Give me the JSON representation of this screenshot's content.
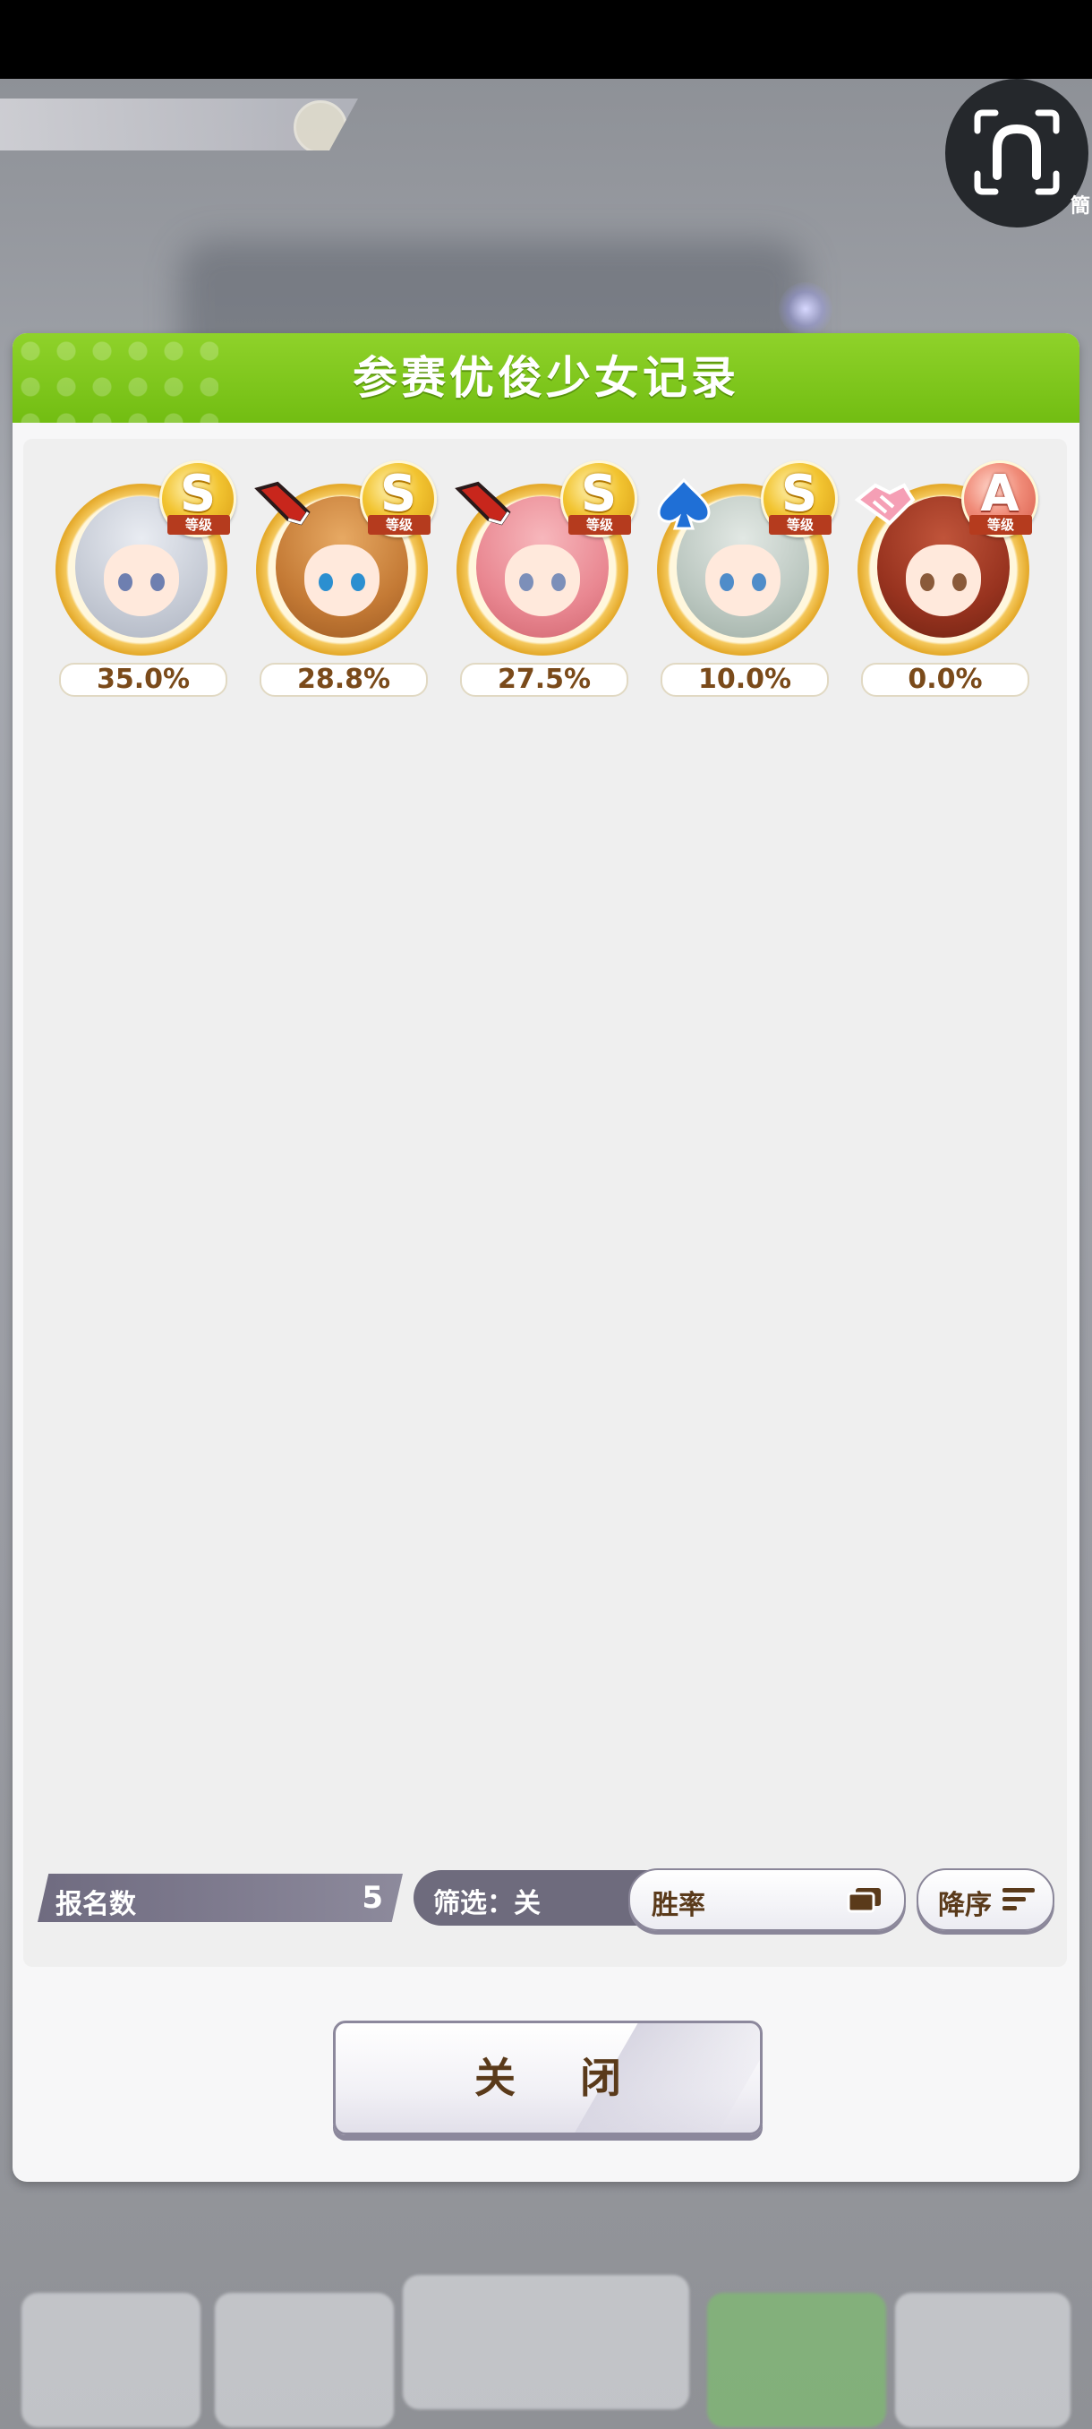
{
  "background": {
    "top_banner_text": "",
    "bottom_nav": []
  },
  "camera_button": {
    "icon": "horseshoe-camera-icon",
    "lang_label": "簡"
  },
  "dialog": {
    "title": "参赛优俊少女记录",
    "characters": [
      {
        "grade": "S",
        "grade_sub": "等级",
        "badge": "none",
        "win_rate": "35.0%"
      },
      {
        "grade": "S",
        "grade_sub": "等级",
        "badge": "shoe-icon",
        "win_rate": "28.8%"
      },
      {
        "grade": "S",
        "grade_sub": "等级",
        "badge": "shoe-icon",
        "win_rate": "27.5%"
      },
      {
        "grade": "S",
        "grade_sub": "等级",
        "badge": "spade-icon",
        "win_rate": "10.0%"
      },
      {
        "grade": "A",
        "grade_sub": "等级",
        "badge": "handshake-icon",
        "win_rate": "0.0%"
      }
    ],
    "registration": {
      "label": "报名数",
      "count": "5"
    },
    "filter": {
      "label": "筛选：关"
    },
    "sort": {
      "selected": "胜率",
      "order": "降序"
    },
    "close_label": "关 闭"
  },
  "colors": {
    "header_green": "#7cc61a",
    "text_brown": "#5a3a1a",
    "panel_gray": "#efefef",
    "grade_gold": "#f2c431",
    "grade_red": "#f08b78"
  }
}
